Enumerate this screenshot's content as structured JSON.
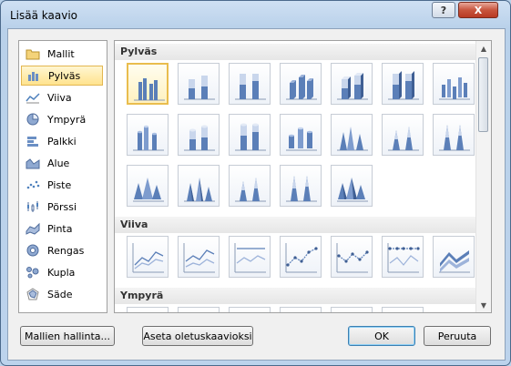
{
  "window": {
    "title": "Lisää kaavio"
  },
  "titlebar": {
    "help_label": "?",
    "close_label": "X"
  },
  "sidebar": {
    "items": [
      {
        "label": "Mallit",
        "icon": "folder-icon",
        "selected": false
      },
      {
        "label": "Pylväs",
        "icon": "column-chart-icon",
        "selected": true
      },
      {
        "label": "Viiva",
        "icon": "line-chart-icon",
        "selected": false
      },
      {
        "label": "Ympyrä",
        "icon": "pie-chart-icon",
        "selected": false
      },
      {
        "label": "Palkki",
        "icon": "bar-chart-icon",
        "selected": false
      },
      {
        "label": "Alue",
        "icon": "area-chart-icon",
        "selected": false
      },
      {
        "label": "Piste",
        "icon": "scatter-chart-icon",
        "selected": false
      },
      {
        "label": "Pörssi",
        "icon": "stock-chart-icon",
        "selected": false
      },
      {
        "label": "Pinta",
        "icon": "surface-chart-icon",
        "selected": false
      },
      {
        "label": "Rengas",
        "icon": "doughnut-chart-icon",
        "selected": false
      },
      {
        "label": "Kupla",
        "icon": "bubble-chart-icon",
        "selected": false
      },
      {
        "label": "Säde",
        "icon": "radar-chart-icon",
        "selected": false
      }
    ]
  },
  "gallery": {
    "sections": [
      {
        "title": "Pylväs"
      },
      {
        "title": "Viiva"
      },
      {
        "title": "Ympyrä"
      }
    ]
  },
  "footer": {
    "manage_templates_label": "Mallien hallinta...",
    "set_default_label": "Aseta oletuskaavioksi",
    "ok_label": "OK",
    "cancel_label": "Peruuta"
  },
  "colors": {
    "accent_blue": "#4f81bd",
    "selection_gold": "#e9bd4e"
  }
}
